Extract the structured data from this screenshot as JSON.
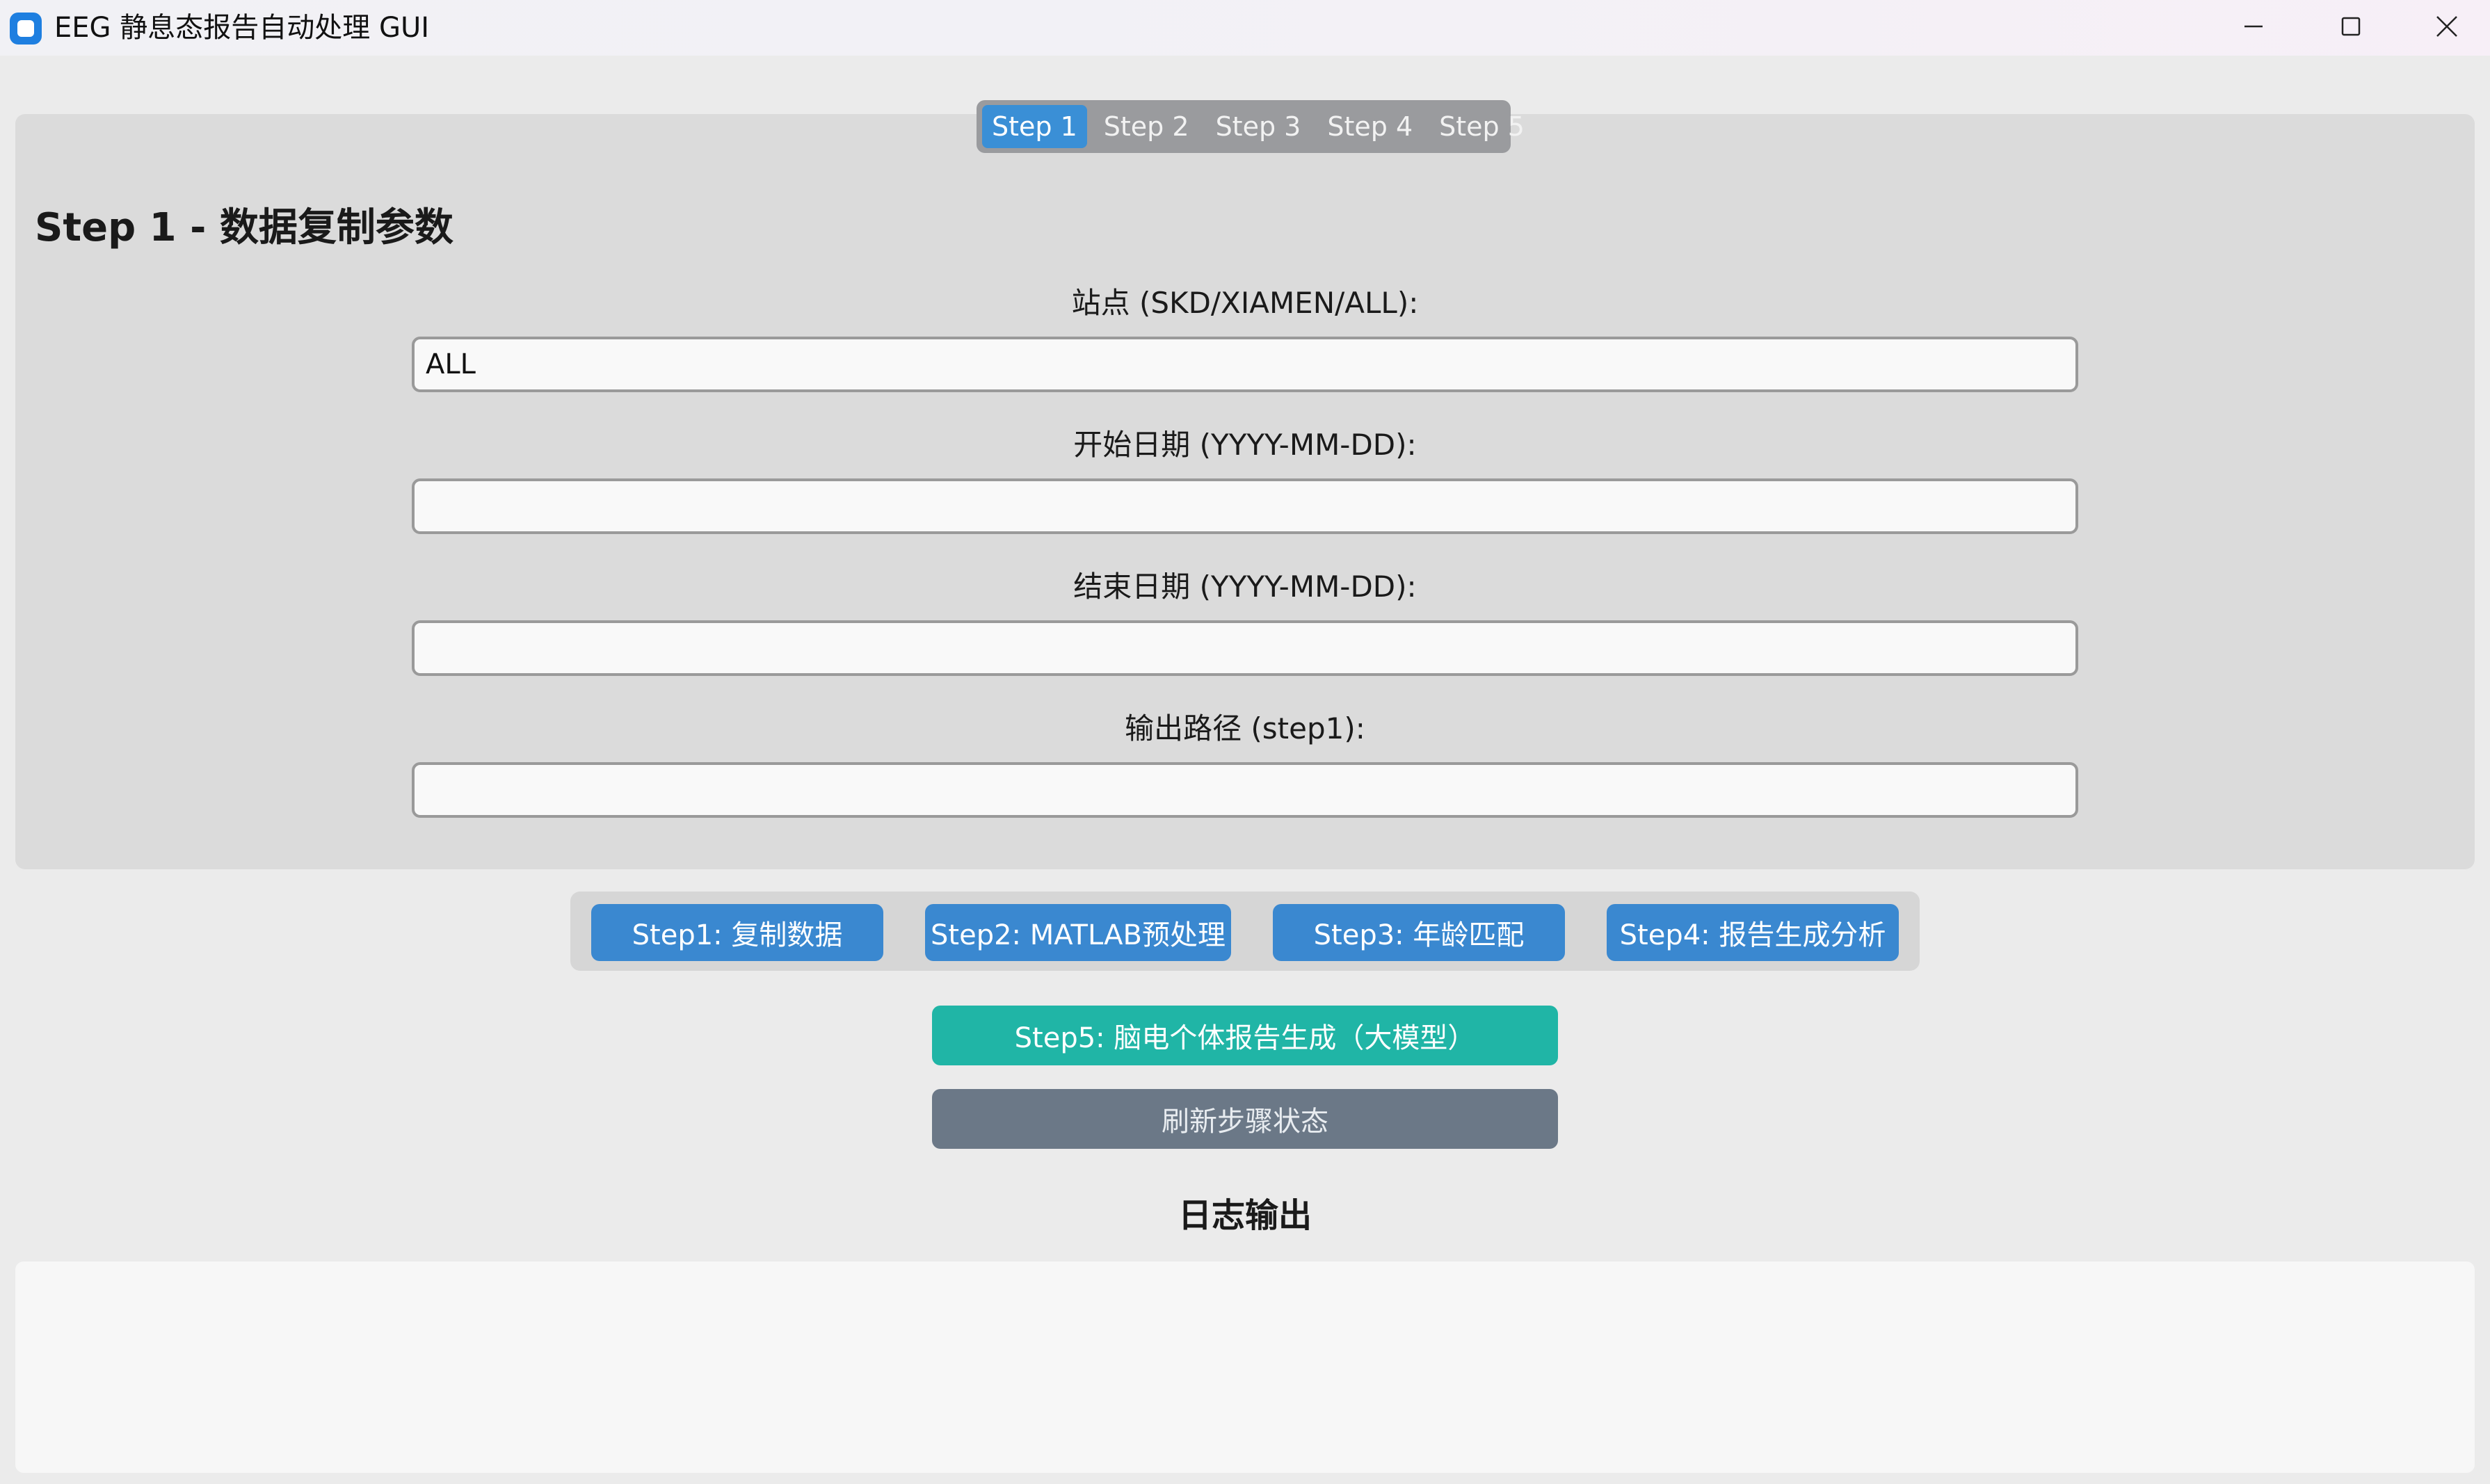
{
  "window": {
    "title": "EEG 静息态报告自动处理 GUI",
    "app_icon": "app-icon",
    "controls": [
      "minimize-icon",
      "maximize-icon",
      "close-icon"
    ]
  },
  "tabs": [
    {
      "label": "Step 1",
      "active": true
    },
    {
      "label": "Step 2",
      "active": false
    },
    {
      "label": "Step 3",
      "active": false
    },
    {
      "label": "Step 4",
      "active": false
    },
    {
      "label": "Step 5",
      "active": false
    }
  ],
  "form": {
    "title": "Step 1 - 数据复制参数",
    "fields": [
      {
        "label": "站点 (SKD/XIAMEN/ALL):",
        "value": ""
      },
      {
        "label": "开始日期 (YYYY-MM-DD):",
        "value": ""
      },
      {
        "label": "结束日期 (YYYY-MM-DD):",
        "value": ""
      },
      {
        "label": "输出路径 (step1):",
        "value": ""
      }
    ],
    "site_value": "ALL"
  },
  "actions": {
    "step1": "Step1: 复制数据",
    "step2": "Step2: MATLAB预处理",
    "step3": "Step3: 年龄匹配",
    "step4": "Step4: 报告生成分析",
    "step5": "Step5: 脑电个体报告生成（大模型）",
    "refresh": "刷新步骤状态"
  },
  "log": {
    "title": "日志输出",
    "content": ""
  },
  "colors": {
    "tab_active": "#3a8fd6",
    "step_button": "#3a88d0",
    "step5_button": "#20b5a6",
    "refresh_button": "#6b7887",
    "app_icon": "#1e7fe0"
  }
}
